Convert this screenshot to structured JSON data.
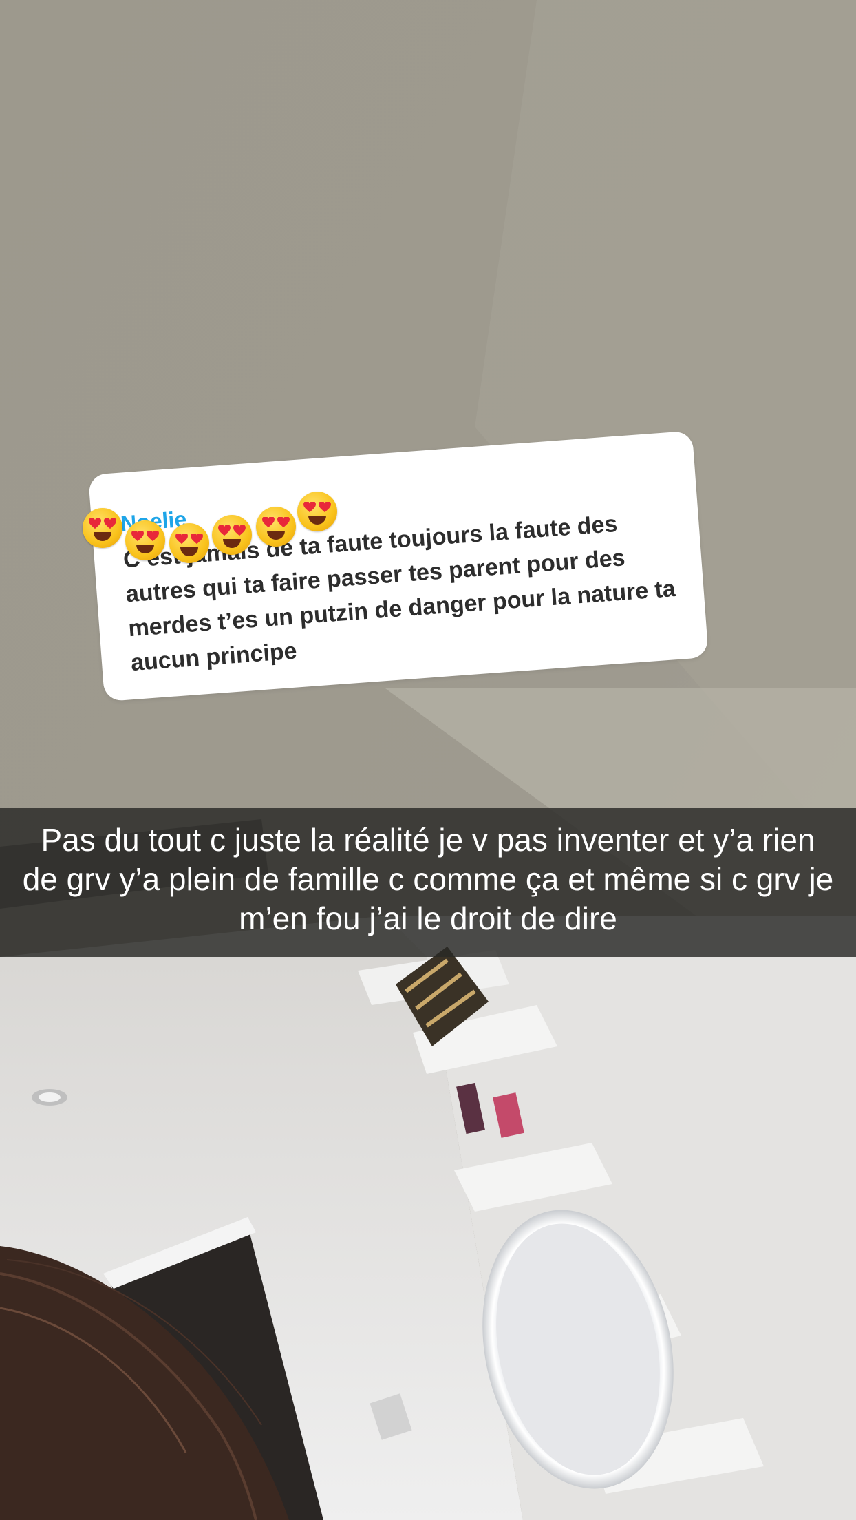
{
  "reply": {
    "sender_name": "Noelie",
    "message": "C’est jamais de ta faute toujours la faute des autres qui ta faire passer tes parent pour des merdes t’es un putzin de danger pour la nature ta aucun principe"
  },
  "sticker": {
    "icon": "heart-eyes-emoji",
    "count": 6
  },
  "caption": {
    "text": "Pas du tout c juste la réalité je v pas inventer et y’a rien de grv y’a plein de famille c comme ça et même si c grv je m’en fou j’ai le droit de dire"
  },
  "colors": {
    "name_accent": "#1ea5e8",
    "card_bg": "#ffffff",
    "caption_bg": "#282826"
  }
}
